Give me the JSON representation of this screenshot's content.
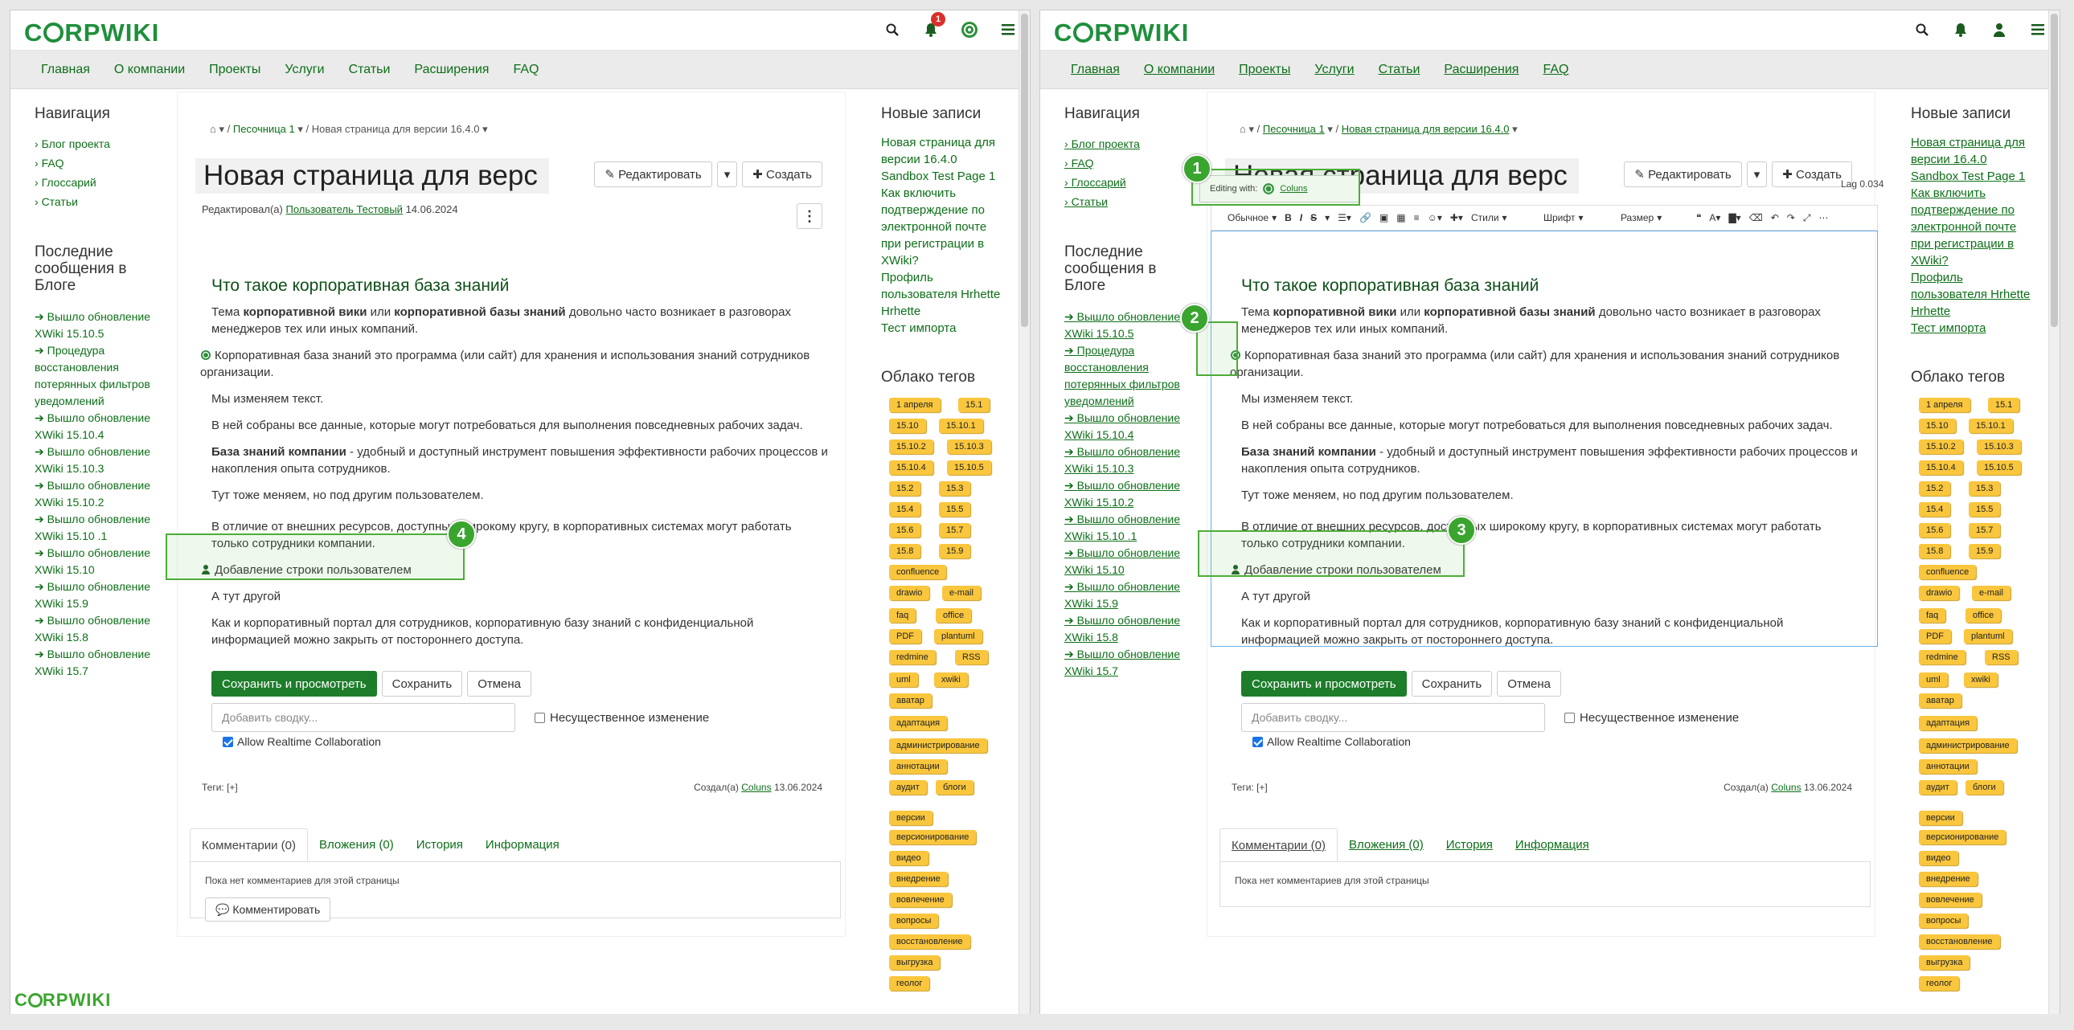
{
  "brand": {
    "logo": "CORPWIKI",
    "small_logo": "CORPWIKI",
    "accent": "#1f8f3c"
  },
  "topbar": {
    "notif_count": "1"
  },
  "nav": [
    "Главная",
    "О компании",
    "Проекты",
    "Услуги",
    "Статьи",
    "Расширения",
    "FAQ"
  ],
  "left": {
    "nav_title": "Навигация",
    "nav_items": [
      "Блог проекта",
      "FAQ",
      "Глоссарий",
      "Статьи"
    ],
    "blog_title": "Последние сообщения в Блоге",
    "blog_items": [
      "Вышло обновление XWiki 15.10.5",
      "Процедура восстановления потерянных фильтров уведомлений",
      "Вышло обновление XWiki 15.10.4",
      "Вышло обновление XWiki 15.10.3",
      "Вышло обновление XWiki 15.10.2",
      "Вышло обновление XWiki 15.10 .1",
      "Вышло обновление XWiki 15.10",
      "Вышло обновление XWiki 15.9",
      "Вышло обновление XWiki 15.8",
      "Вышло обновление XWiki 15.7"
    ],
    "blog_items_r": [
      "Вышло обновление XWiki 15.10.5",
      "Процедура восстановления потерянных фильтров уведомлений",
      "Вышло обновление XWiki 15.10.4",
      "Вышло обновление XWiki 15.10.3",
      "Вышло обновление XWiki 15.10.2",
      "Вышло обновление XWiki 15.10 .1",
      "Вышло обновление XWiki 15.10",
      "Вышло обновление XWiki 15.9",
      "Вышло обновление XWiki 15.8",
      "Вышло обновление XWiki 15.7"
    ]
  },
  "page": {
    "breadcrumb_1": "Песочница 1",
    "breadcrumb_2": "Новая страница для версии 16.4.0",
    "title": "Новая страница для верс",
    "edit_btn": "Редактировать",
    "create_btn": "Создать",
    "meta_prefix": "Редактировал(а)",
    "meta_user": "Пользователь Тестовый",
    "meta_date": "14.06.2024",
    "h2": "Что такое корпоративная база знаний",
    "p1_a": "Тема ",
    "p1_b": "корпоративной вики",
    "p1_c": " или ",
    "p1_d": "корпоративной базы знаний",
    "p1_e": " довольно часто возникает в разговорах менеджеров тех или иных компаний.",
    "p2": "Корпоративная база знаний это программа (или сайт) для хранения и использования знаний сотрудников организации.",
    "p3": "Мы изменяем текст.",
    "p4": "В ней собраны все данные, которые могут потребоваться для выполнения повседневных рабочих задач.",
    "p5_a": "База знаний компании",
    "p5_b": " - удобный и доступный инструмент повышения эффективности рабочих процессов и накопления опыта сотрудников.",
    "p6": "Тут тоже меняем, но под другим пользователем.",
    "p7": "В отличие от внешних ресурсов, доступных широкому кругу, в корпоративных системах могут работать только сотрудники компании.",
    "p8": "Добавление строки пользователем",
    "p9": "А тут другой",
    "p10": "Как и корпоративный портал для сотрудников, корпоративную базу знаний с конфиденциальной информацией можно закрыть от постороннего доступа.",
    "save_view": "Сохранить и просмотреть",
    "save": "Сохранить",
    "cancel": "Отмена",
    "summary_ph": "Добавить сводку...",
    "minor": "Несущественное изменение",
    "rtc": "Allow Realtime Collaboration",
    "tags": "Теги:",
    "tags_add": "[+]",
    "created_prefix": "Создал(а)",
    "created_user": "Coluns",
    "created_date": "13.06.2024",
    "tabs": [
      "Комментарии (0)",
      "Вложения (0)",
      "История",
      "Информация"
    ],
    "no_comments": "Пока нет комментариев для этой страницы",
    "comment_btn": "Комментировать"
  },
  "editor": {
    "editing_with": "Editing with:",
    "editor_user": "Coluns",
    "lag": "Lag 0.034",
    "style": "Обычное",
    "styles": "Стили",
    "font": "Шрифт",
    "size": "Размер"
  },
  "right": {
    "news_title": "Новые записи",
    "news": [
      "Новая страница для версии 16.4.0",
      "Sandbox Test Page 1",
      "Как включить подтверждение по электронной почте при регистрации в XWiki?",
      "Профиль пользователя Hrhette Hrhette",
      "Тест импорта"
    ],
    "cloud_title": "Облако тегов",
    "cloud": [
      "1 апреля",
      "15.1",
      "15.10",
      "15.10.1",
      "15.10.2",
      "15.10.3",
      "15.10.4",
      "15.10.5",
      "15.2",
      "15.3",
      "15.4",
      "15.5",
      "15.6",
      "15.7",
      "15.8",
      "15.9",
      "confluence",
      "drawio",
      "e-mail",
      "faq",
      "office",
      "PDF",
      "plantuml",
      "redmine",
      "RSS",
      "uml",
      "xwiki",
      "аватар",
      "адаптация",
      "администрирование",
      "аннотации",
      "аудит",
      "блоги",
      "версии",
      "версионирование",
      "видео",
      "внедрение",
      "вовлечение",
      "вопросы",
      "восстановление",
      "выгрузка",
      "геолог"
    ]
  },
  "callouts": [
    "1",
    "2",
    "3",
    "4"
  ]
}
